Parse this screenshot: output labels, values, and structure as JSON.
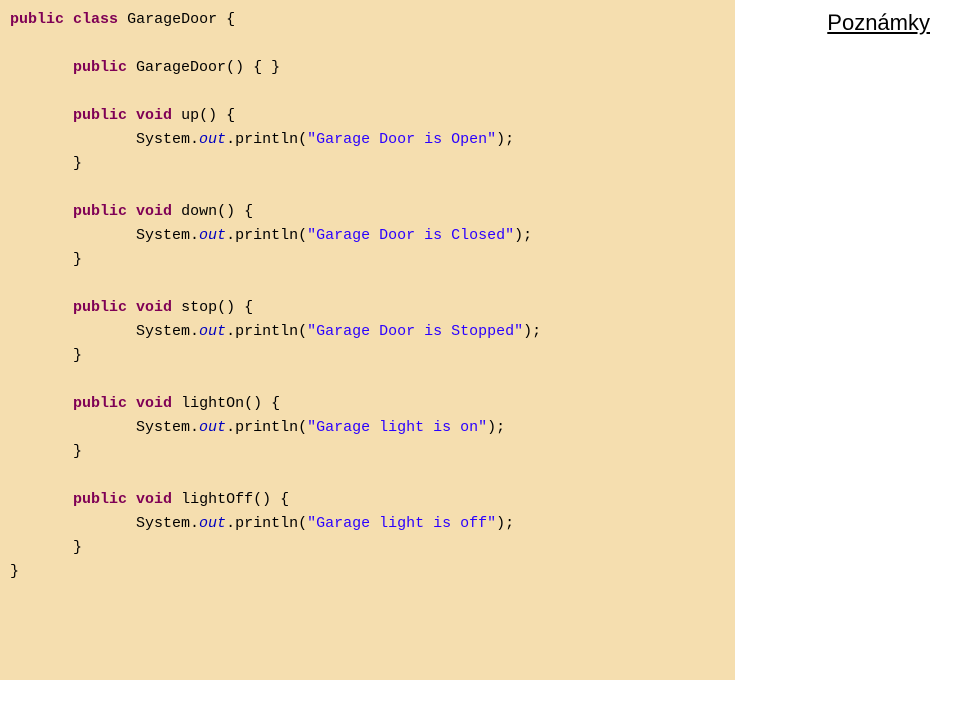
{
  "page": {
    "title": "Poznámky"
  },
  "code": {
    "class_decl": {
      "kw_public": "public",
      "kw_class": "class",
      "name": "GarageDoor {"
    },
    "ctor": {
      "kw_public": "public",
      "name": "GarageDoor() { }"
    },
    "up": {
      "kw_public": "public",
      "kw_void": "void",
      "name": "up() {",
      "sysout": "System.",
      "out": "out",
      "println": ".println(",
      "str": "\"Garage Door is Open\"",
      "close": ");",
      "brace": "}"
    },
    "down": {
      "kw_public": "public",
      "kw_void": "void",
      "name": "down() {",
      "sysout": "System.",
      "out": "out",
      "println": ".println(",
      "str": "\"Garage Door is Closed\"",
      "close": ");",
      "brace": "}"
    },
    "stop": {
      "kw_public": "public",
      "kw_void": "void",
      "name": "stop() {",
      "sysout": "System.",
      "out": "out",
      "println": ".println(",
      "str": "\"Garage Door is Stopped\"",
      "close": ");",
      "brace": "}"
    },
    "lightOn": {
      "kw_public": "public",
      "kw_void": "void",
      "name": "lightOn() {",
      "sysout": "System.",
      "out": "out",
      "println": ".println(",
      "str": "\"Garage light is on\"",
      "close": ");",
      "brace": "}"
    },
    "lightOff": {
      "kw_public": "public",
      "kw_void": "void",
      "name": "lightOff() {",
      "sysout": "System.",
      "out": "out",
      "println": ".println(",
      "str": "\"Garage light is off\"",
      "close": ");",
      "brace": "}"
    },
    "class_close": "}"
  }
}
